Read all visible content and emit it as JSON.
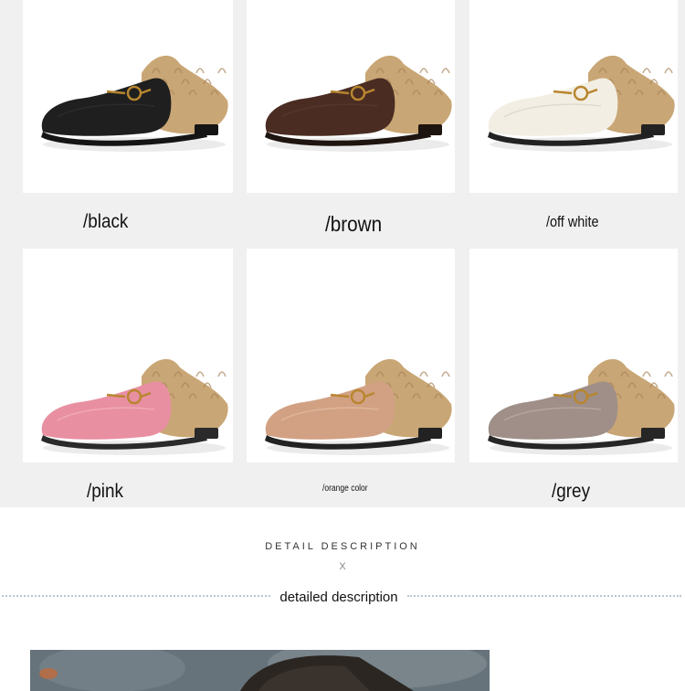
{
  "products": [
    {
      "label": "/black",
      "shoe": "black-leather-fur-mule",
      "upper": "#1f1f1f",
      "lining": "#2e2e2e",
      "sole": "#151515"
    },
    {
      "label": "/brown",
      "shoe": "brown-leather-fur-mule",
      "upper": "#4a2c22",
      "lining": "#5a3a2c",
      "sole": "#1e1410"
    },
    {
      "label": "/off white",
      "shoe": "off-white-leather-fur-mule",
      "upper": "#f2eee3",
      "lining": "#dcd6c7",
      "sole": "#222222"
    },
    {
      "label": "/pink",
      "shoe": "pink-leather-fur-mule",
      "upper": "#e98fa2",
      "lining": "#f2b0bd",
      "sole": "#2a2a2a"
    },
    {
      "label": "/orange color",
      "shoe": "orange-beige-leather-fur-mule",
      "upper": "#d2a184",
      "lining": "#e3bba1",
      "sole": "#222222"
    },
    {
      "label": "/grey",
      "shoe": "grey-leather-fur-mule",
      "upper": "#9f8f88",
      "lining": "#b8aaa3",
      "sole": "#262626"
    }
  ],
  "detail": {
    "title": "DETAIL DESCRIPTION",
    "marker": "X",
    "subtitle": "detailed description"
  },
  "colors": {
    "fur": "#c9a675",
    "fur_dark": "#a9845a",
    "buckle": "#b8862f",
    "panel_bg": "#f0f0f0"
  }
}
